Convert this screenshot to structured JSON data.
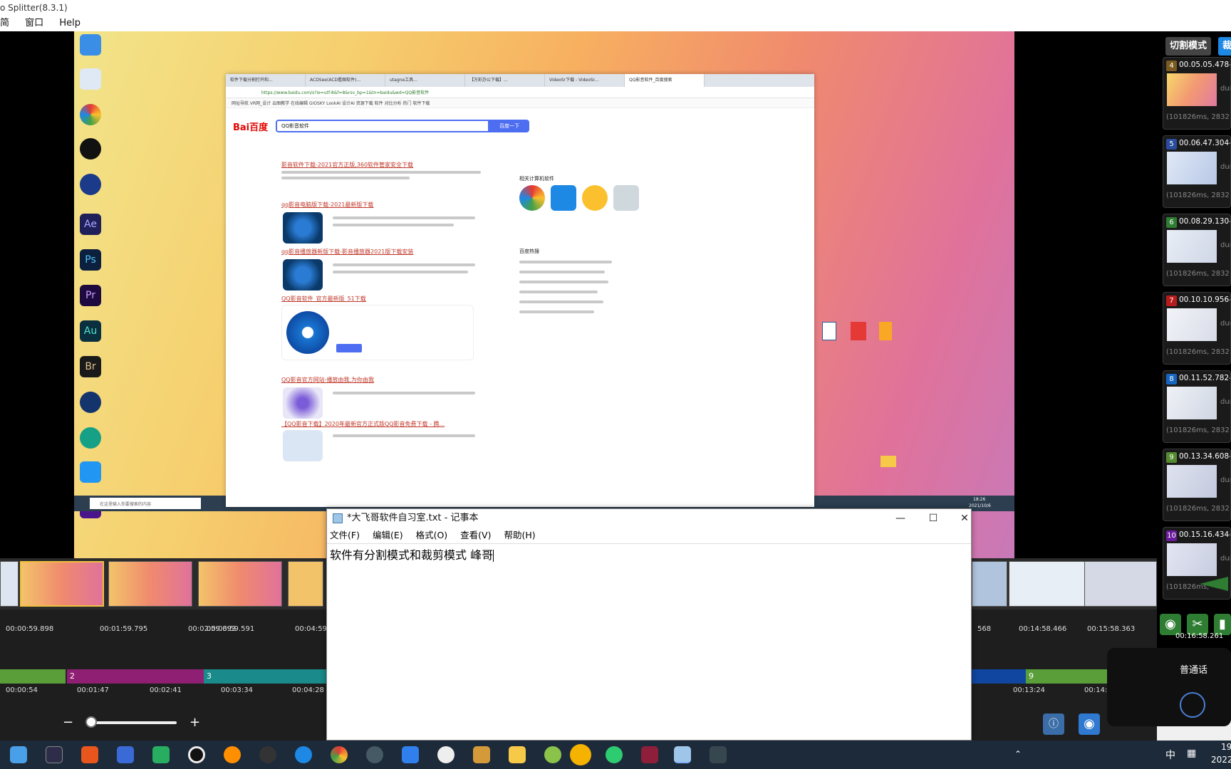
{
  "app": {
    "title": "o Splitter(8.3.1)",
    "menu": [
      "简",
      "窗口",
      "Help"
    ]
  },
  "browser": {
    "tabs": [
      "软件下载分割打开和...",
      "ACDSee(ACD看图软件)...",
      "utagne工具...",
      "【万彩办公下载】...",
      "VideoSr下载 - VideoSr...",
      "QQ影音软件_百度搜索"
    ],
    "url": "https://www.baidu.com/s?ie=utf-8&f=8&rsv_bp=1&tn=baidu&wd=QQ影音软件",
    "bookmarks": "网址导航  VR网_设计  云图教学  在线编辑  GIOSKY  LookAI  设计AI  资源下载  软件  对比分析  热门  软件下载",
    "logo": "Bai百度",
    "query": "QQ影音软件",
    "search_btn": "百度一下",
    "results": [
      "影音软件下载-2021官方正版,360软件管家安全下载",
      "qq影音电脑版下载-2021最新版下载",
      "qq影音播放器新版下载-影音播放器2021版下载安装",
      "QQ影音软件_官方最新版_51下载",
      "QQ影音官方网站-播放由我,为你由我",
      "【QQ影音下载】2020年最新官方正式版QQ影音免费下载 - 腾..."
    ],
    "side_related": "相关计算机软件",
    "side_hot": "百度热搜"
  },
  "notepad": {
    "title": "*大飞哥软件自习室.txt - 记事本",
    "menu": [
      "文件(F)",
      "编辑(E)",
      "格式(O)",
      "查看(V)",
      "帮助(H)"
    ],
    "content": "软件有分割模式和裁剪模式  峰哥"
  },
  "right_panel": {
    "mode_split": "切割模式",
    "mode_crop": "裁剪",
    "clips": [
      {
        "num": "4",
        "tc": "00.05.05.478-00",
        "info": "(101826ms, 2832",
        "dur": "dur",
        "color": "#7a5a1e"
      },
      {
        "num": "5",
        "tc": "00.06.47.304-00",
        "info": "(101826ms, 2832",
        "dur": "dur",
        "color": "#2a4c9e"
      },
      {
        "num": "6",
        "tc": "00.08.29.130-00",
        "info": "(101826ms, 2832",
        "dur": "dur",
        "color": "#2e7d32"
      },
      {
        "num": "7",
        "tc": "00.10.10.956-00",
        "info": "(101826ms, 2832",
        "dur": "dur",
        "color": "#b71c1c"
      },
      {
        "num": "8",
        "tc": "00.11.52.782-00",
        "info": "(101826ms, 2832",
        "dur": "dur",
        "color": "#1565c0"
      },
      {
        "num": "9",
        "tc": "00.13.34.608-00",
        "info": "(101826ms, 2832",
        "dur": "dur",
        "color": "#558b2f"
      },
      {
        "num": "10",
        "tc": "00.15.16.434-0",
        "info": "(101826ms,",
        "dur": "dur",
        "color": "#6a1b9a"
      }
    ]
  },
  "timeline": {
    "ruler1": [
      "00:00:59.898",
      "00:01:59.795",
      "00:02:59.693",
      "00:03:59.591",
      "00:04:59.",
      "568",
      "00:14:58.466",
      "00:15:58.363"
    ],
    "end_time": "00:16:58.261",
    "segments": [
      "2",
      "3",
      "9"
    ],
    "ruler2": [
      "00:00:54",
      "00:01:47",
      "00:02:41",
      "00:03:34",
      "00:04:28",
      "00:13:24",
      "00:14:"
    ]
  },
  "voice": {
    "label": "普通话"
  },
  "taskbar": {
    "clock": "19",
    "date": "2022",
    "ime": "中",
    "browser_taskbar_time": "18:26",
    "browser_taskbar_date": "2021/10/6",
    "search_placeholder": "在这里输入你要搜索的内容"
  }
}
